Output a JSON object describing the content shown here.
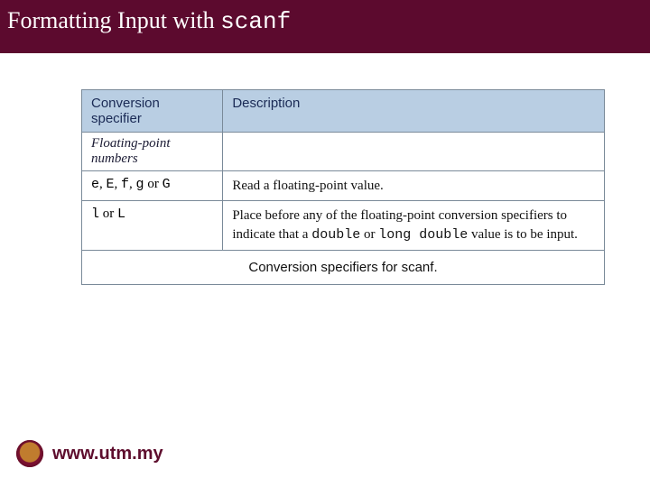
{
  "title": {
    "prefix": "Formatting Input with ",
    "mono": "scanf"
  },
  "table": {
    "headers": {
      "col1": "Conversion specifier",
      "col2": "Description"
    },
    "section_label": "Floating-point numbers",
    "rows": [
      {
        "spec_parts": {
          "a": "e",
          "sep1": ", ",
          "b1": "E",
          "sep2": ", ",
          "b2": "f",
          "sep3": ", ",
          "c": "g",
          "sep4": " or ",
          "d": "G"
        },
        "desc": "Read a floating-point value."
      },
      {
        "spec_parts": {
          "a": "l",
          "sep1": " or ",
          "b": "L"
        },
        "desc_parts": {
          "p1": "Place before any of the floating-point conversion specifiers to indicate that a ",
          "kw1": "double",
          "p2": " or ",
          "kw2": "long double",
          "p3": " value is to be input."
        }
      }
    ],
    "caption": "Conversion specifiers for scanf."
  },
  "footer": {
    "url": "www.utm.my"
  },
  "colors": {
    "header_bg": "#5c0a2e",
    "table_header_bg": "#b9cee3"
  }
}
